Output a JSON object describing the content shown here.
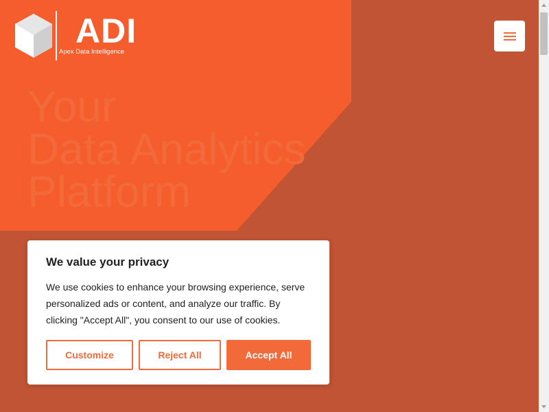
{
  "colors": {
    "background": "#c05434",
    "accent": "#f26a3a",
    "white": "#ffffff",
    "text": "#212121"
  },
  "header": {
    "logo_text": "ADI",
    "logo_tagline": "Apex Data Intelligence",
    "logo_icon": "hexagon-cube-icon",
    "menu_icon": "hamburger-menu-icon"
  },
  "hero": {
    "title_lines": [
      "Your",
      "Data Analytics",
      "Platform"
    ]
  },
  "cookie_banner": {
    "title": "We value your privacy",
    "body": "We use cookies to enhance your browsing experience, serve personalized ads or content, and analyze our traffic. By clicking \"Accept All\", you consent to our use of cookies.",
    "buttons": {
      "customize": "Customize",
      "reject": "Reject All",
      "accept": "Accept All"
    }
  }
}
